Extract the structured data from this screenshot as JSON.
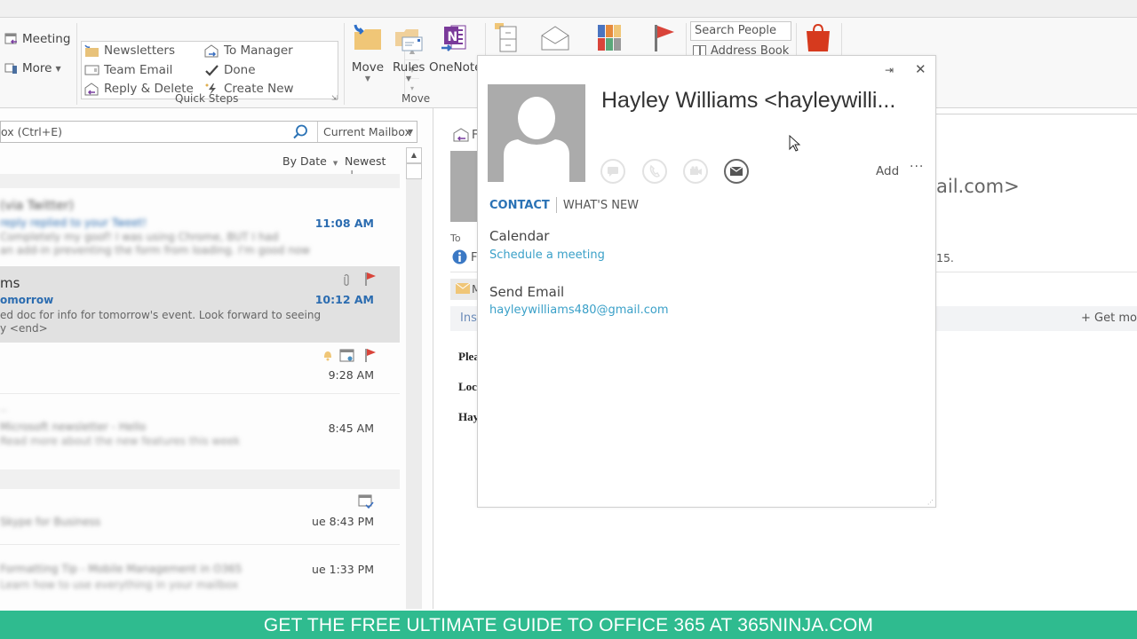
{
  "ribbon": {
    "respond_group": {
      "meeting_label": "Meeting",
      "more_label": "More"
    },
    "quick_steps": {
      "group_label": "Quick Steps",
      "items": [
        {
          "label": "Newsletters",
          "icon": "folder-move-icon"
        },
        {
          "label": "Team Email",
          "icon": "email-icon"
        },
        {
          "label": "Reply & Delete",
          "icon": "reply-delete-icon"
        },
        {
          "label": "To Manager",
          "icon": "forward-icon"
        },
        {
          "label": "Done",
          "icon": "checkmark-icon"
        },
        {
          "label": "Create New",
          "icon": "lightning-icon"
        }
      ]
    },
    "move_group": {
      "group_label": "Move",
      "move_label": "Move",
      "rules_label": "Rules",
      "onenote_label": "OneNote"
    },
    "find_group": {
      "search_people_placeholder": "Search People",
      "address_book_label": "Address Book"
    }
  },
  "search": {
    "placeholder": "ox (Ctrl+E)",
    "scope": "Current Mailbox"
  },
  "sort": {
    "by_label": "By Date",
    "order_label": "Newest"
  },
  "messages": [
    {
      "sender": "(via Twitter)",
      "subject": "reply replied to your Tweet!",
      "preview": "Completely my goof! I was using Chrome, BUT I had",
      "preview2": "an add-in preventing the form from loading. I'm good now",
      "time": "11:08 AM",
      "unread": true
    },
    {
      "sender": "ms",
      "subject": "omorrow",
      "preview": "ed doc for info for tomorrow's event.   Look forward to seeing",
      "preview2": "y <end>",
      "time": "10:12 AM",
      "unread": true,
      "selected": true,
      "attachment": true,
      "flagged": true
    },
    {
      "sender": "",
      "subject": "",
      "preview": "",
      "time": "9:28 AM",
      "reminder": true,
      "meeting": true,
      "flagged": true
    },
    {
      "sender": "",
      "subject": "Microsoft newsletter - Hello",
      "preview": "Read more about the new features this week",
      "time": "8:45 AM"
    },
    {
      "sender": "",
      "subject": "Skype for Business",
      "preview": "",
      "time": "ue 8:43 PM",
      "meeting_accepted": true
    },
    {
      "sender": "",
      "subject": "Formatting Tip - Mobile Management in O365",
      "preview": "Learn how to use everything in your mailbox",
      "time": "ue 1:33 PM"
    }
  ],
  "reading_pane": {
    "header_fragment": "F",
    "to_label": "To",
    "info_fragment": "F",
    "from_fragment": "ail.com>",
    "date_fragment": "15.",
    "msg_fragment": "M",
    "insights_fragment": "Insi",
    "get_more_label": "Get mo",
    "body_lines": [
      "Plea",
      "Loc",
      "Hay"
    ]
  },
  "contact_card": {
    "name": "Hayley Williams <hayleywilli...",
    "add_label": "Add",
    "more_label": "···",
    "tabs": {
      "contact": "CONTACT",
      "whats_new": "WHAT'S NEW"
    },
    "calendar_heading": "Calendar",
    "schedule_link": "Schedule a meeting",
    "send_email_heading": "Send Email",
    "email": "hayleywilliams480@gmail.com"
  },
  "banner": {
    "text": "GET THE FREE ULTIMATE GUIDE TO OFFICE 365 AT 365NINJA.COM"
  },
  "colors": {
    "accent_blue": "#2a72b5",
    "link_teal": "#3aa0c8",
    "flag_red": "#d9443a",
    "banner_green": "#2fbb8f"
  }
}
